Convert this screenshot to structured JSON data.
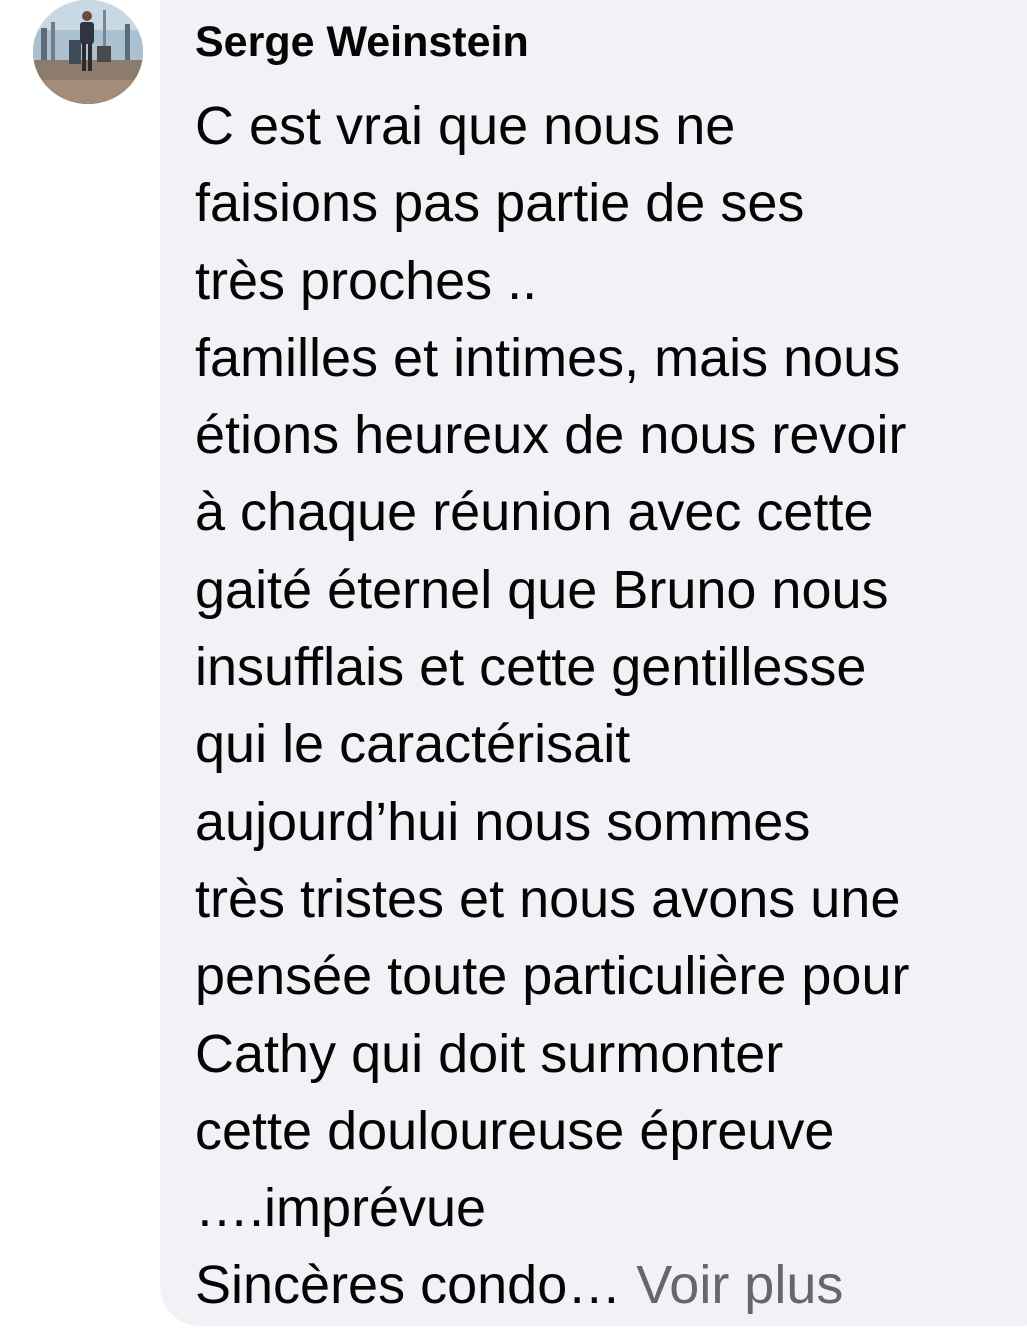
{
  "comment": {
    "author": "Serge Weinstein",
    "lines": [
      "C est vrai que nous ne",
      "faisions pas partie de ses",
      "très proches ..",
      "familles et intimes, mais nous",
      "étions heureux de nous revoir",
      "à chaque réunion avec cette",
      "gaité éternel que Bruno nous",
      "insufflais et cette gentillesse",
      "qui le caractérisait",
      "aujourd’hui nous sommes",
      "très tristes et nous avons une",
      "pensée toute particulière pour",
      "Cathy qui doit surmonter",
      "cette douloureuse épreuve",
      "….imprévue"
    ],
    "truncated_line": "Sincères condo…",
    "see_more_label": "Voir plus"
  },
  "colors": {
    "bubble_background": "#f0f2f5",
    "text": "#050505",
    "see_more": "#65676b"
  },
  "icons": {
    "avatar": "profile-photo"
  }
}
